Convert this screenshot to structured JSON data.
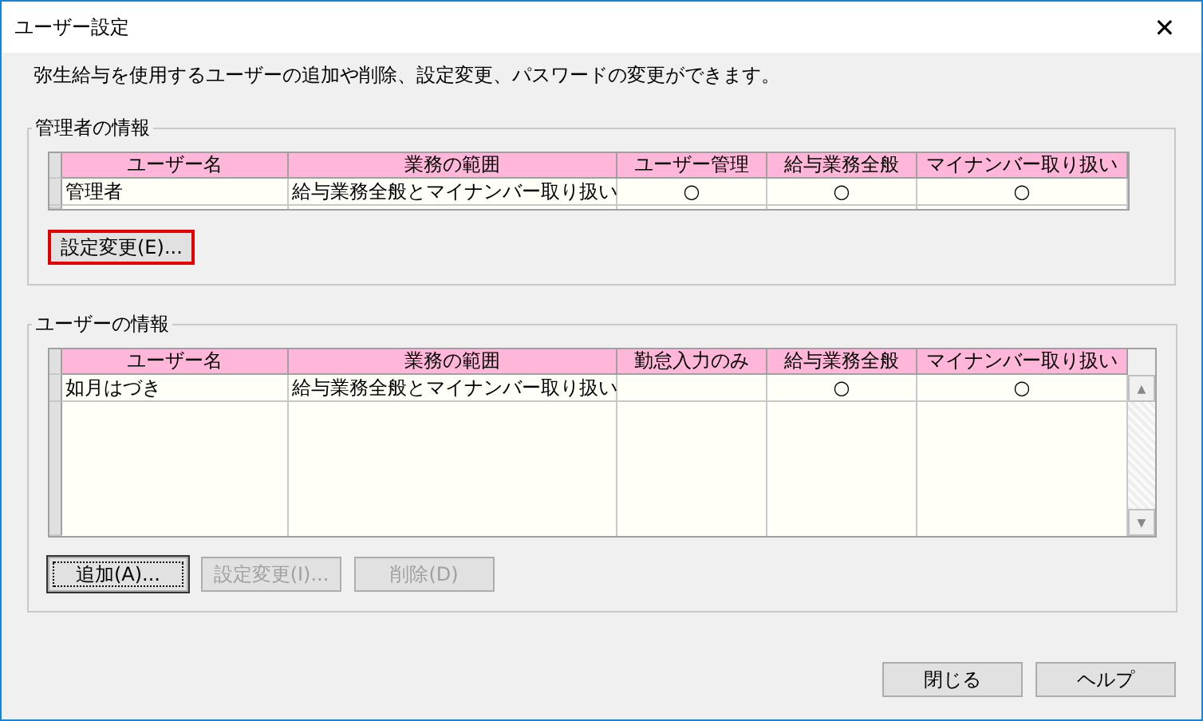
{
  "window": {
    "title": "ユーザー設定",
    "close_glyph": "✕"
  },
  "description": "弥生給与を使用するユーザーの追加や削除、設定変更、パスワードの変更ができます。",
  "admin_group": {
    "title": "管理者の情報",
    "table": {
      "columns": [
        "ユーザー名",
        "業務の範囲",
        "ユーザー管理",
        "給与業務全般",
        "マイナンバー取り扱い"
      ],
      "rows": [
        {
          "cells": [
            "管理者",
            "給与業務全般とマイナンバー取り扱い",
            "○",
            "○",
            "○"
          ]
        }
      ]
    },
    "buttons": [
      {
        "label": "設定変更(E)...",
        "disabled": false,
        "focused": false,
        "highlighted": true
      }
    ]
  },
  "user_group": {
    "title": "ユーザーの情報",
    "table": {
      "columns": [
        "ユーザー名",
        "業務の範囲",
        "勤怠入力のみ",
        "給与業務全般",
        "マイナンバー取り扱い"
      ],
      "rows": [
        {
          "cells": [
            "如月はづき",
            "給与業務全般とマイナンバー取り扱い",
            "",
            "○",
            "○"
          ]
        }
      ],
      "scrollbar": {
        "up": "▲",
        "down": "▼"
      }
    },
    "buttons": [
      {
        "label": "追加(A)...",
        "disabled": false,
        "focused": true,
        "highlighted": false
      },
      {
        "label": "設定変更(I)...",
        "disabled": true,
        "focused": false,
        "highlighted": false
      },
      {
        "label": "削除(D)",
        "disabled": true,
        "focused": false,
        "highlighted": false
      }
    ]
  },
  "footer_buttons": [
    "閉じる",
    "ヘルプ"
  ]
}
